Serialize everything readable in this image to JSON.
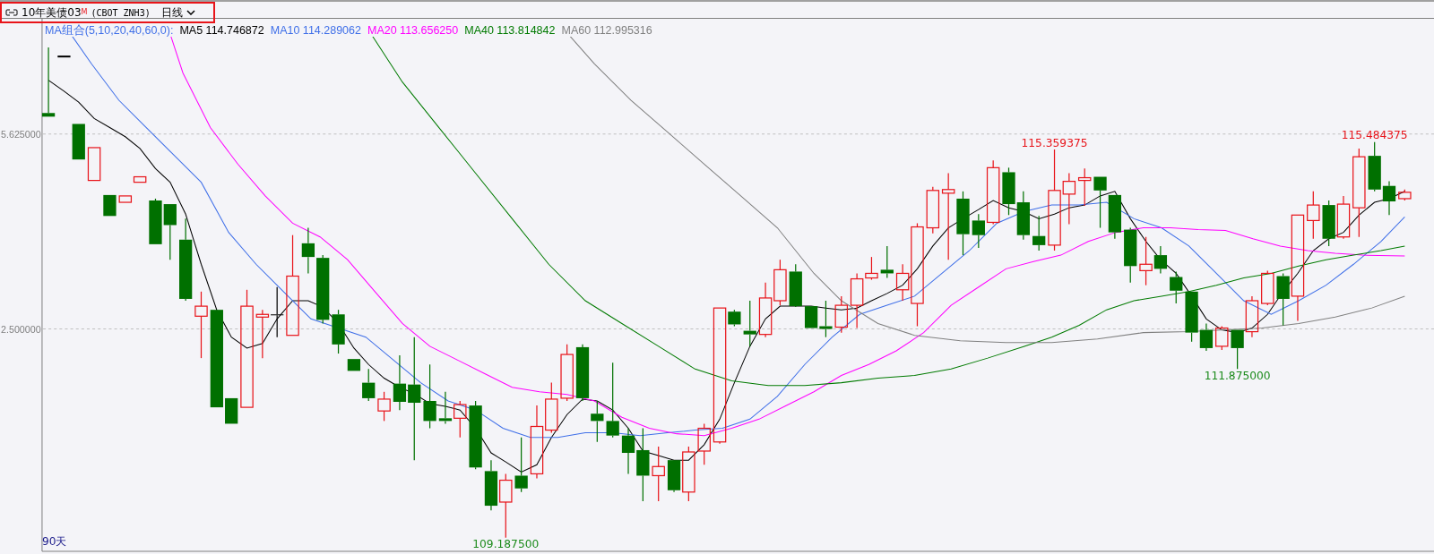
{
  "header": {
    "title": "10年美债03",
    "badge": "M",
    "code": "(CBOT ZNH3)",
    "period": "日线"
  },
  "legend": {
    "label": "MA组合(5,10,20,40,60,0):",
    "items": [
      {
        "name": "MA5",
        "value": "114.746872",
        "color": "#000000"
      },
      {
        "name": "MA10",
        "value": "114.289062",
        "color": "#3f6fe8"
      },
      {
        "name": "MA20",
        "value": "113.656250",
        "color": "#ff00ff"
      },
      {
        "name": "MA40",
        "value": "113.814842",
        "color": "#007a00"
      },
      {
        "name": "MA60",
        "value": "112.995316",
        "color": "#808080"
      }
    ]
  },
  "chart": {
    "yticks": [
      "5.625000",
      "2.500000"
    ],
    "range_label": "90天",
    "annotations": [
      {
        "text": "115.359375",
        "kind": "high"
      },
      {
        "text": "115.484375",
        "kind": "high"
      },
      {
        "text": "111.875000",
        "kind": "low"
      },
      {
        "text": "109.187500",
        "kind": "low"
      }
    ]
  }
}
